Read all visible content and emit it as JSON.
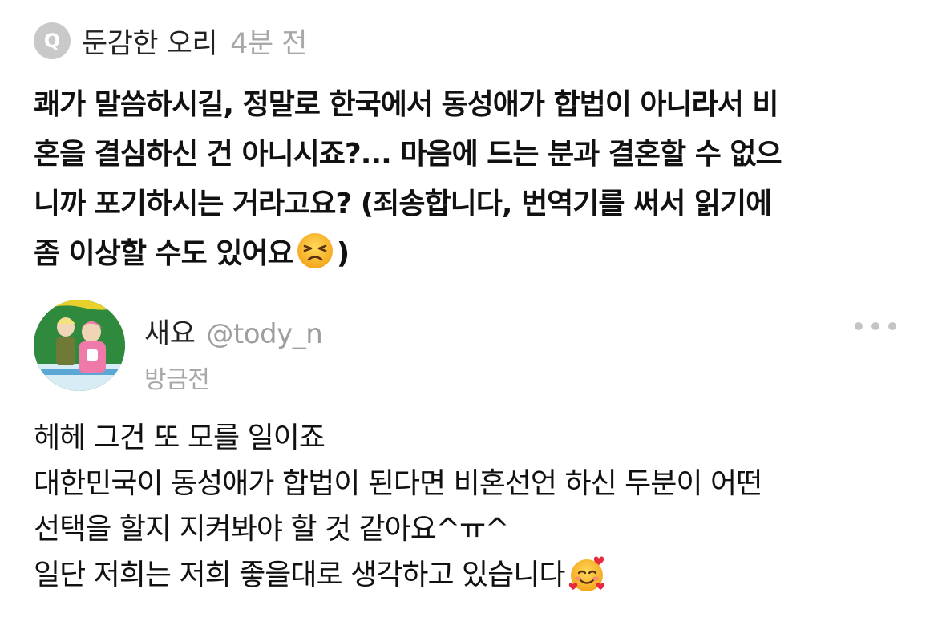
{
  "question": {
    "badge": "Q",
    "asker_name": "둔감한 오리",
    "time": "4분 전",
    "lines": [
      "쾌가 말씀하시길, 정말로 한국에서 동성애가 합법이 아니라서 비",
      "혼을 결심하신 건 아니시죠?... 마음에 드는 분과 결혼할 수 없으",
      "니까 포기하시는 거라고요? (죄송합니다, 번역기를 써서 읽기에"
    ],
    "last_line_text": "좀 이상할 수도 있어요",
    "last_line_emoji": "persevering-face",
    "last_line_tail": ")"
  },
  "answer": {
    "name": "새요",
    "handle": "@tody_n",
    "time": "방금전",
    "lines": [
      "헤헤 그건 또 모를 일이죠",
      "대한민국이 동성애가 합법이 된다면 비혼선언 하신 두분이 어떤",
      "선택을 할지 지켜봐야 할 것 같아요^ㅠ^"
    ],
    "last_line_text": "일단 저희는 저희 좋을대로 생각하고 있습니다",
    "last_line_emoji": "smiling-face-with-hearts"
  },
  "colors": {
    "badge_bg": "#c9c9c9",
    "muted_text": "#a8a8a8",
    "body_text": "#111111",
    "more_dots": "#c4c4c4"
  }
}
